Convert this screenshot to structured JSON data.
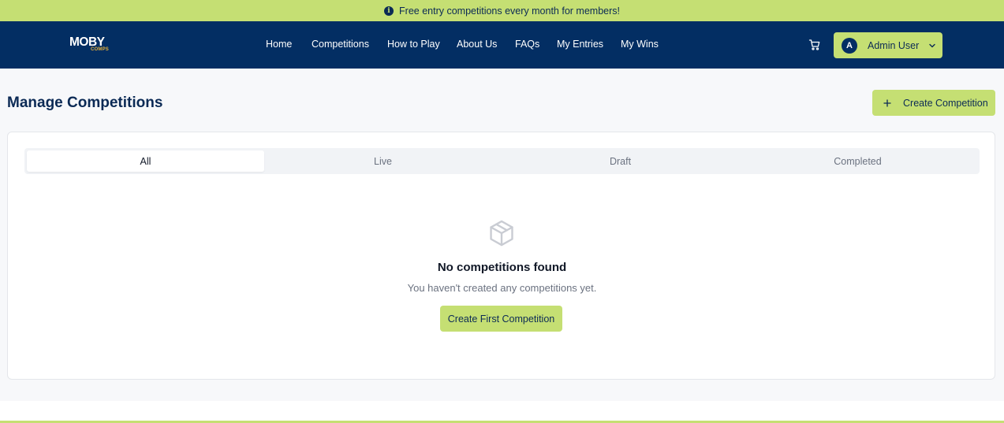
{
  "banner": {
    "icon": "info-icon",
    "text": "Free entry competitions every month for members!"
  },
  "logo": {
    "main": "MOBY",
    "sub": "COMPS"
  },
  "nav": {
    "items": [
      {
        "label": "Home"
      },
      {
        "label": "Competitions"
      },
      {
        "label": "How to Play"
      },
      {
        "label": "About Us"
      },
      {
        "label": "FAQs"
      },
      {
        "label": "My Entries"
      },
      {
        "label": "My Wins"
      }
    ],
    "cart_icon": "cart-icon"
  },
  "user": {
    "initial": "A",
    "name": "Admin User",
    "menu_icon": "chevron-down-icon"
  },
  "page": {
    "title": "Manage Competitions",
    "create_label": "Create Competition"
  },
  "tabs": [
    {
      "label": "All",
      "active": true
    },
    {
      "label": "Live",
      "active": false
    },
    {
      "label": "Draft",
      "active": false
    },
    {
      "label": "Completed",
      "active": false
    }
  ],
  "empty_state": {
    "icon": "package-icon",
    "title": "No competitions found",
    "subtitle": "You haven't created any competitions yet.",
    "button_label": "Create First Competition"
  },
  "colors": {
    "accent": "#c5df73",
    "navy": "#032e63",
    "background": "#f7f8fa"
  }
}
